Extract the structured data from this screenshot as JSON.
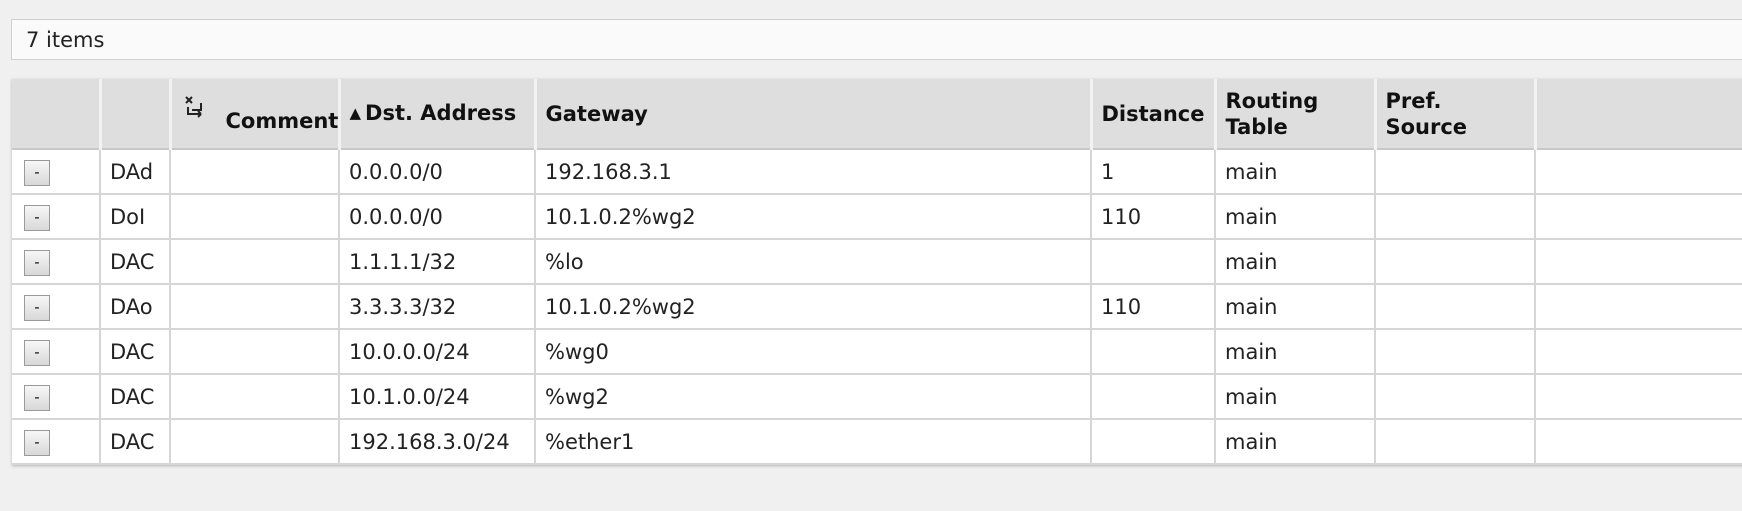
{
  "status": {
    "item_count": "7 items"
  },
  "table": {
    "headers": {
      "comment": "Comment",
      "sort_indicator": "▲",
      "dst_address": "Dst. Address",
      "gateway": "Gateway",
      "distance": "Distance",
      "routing_table": "Routing Table",
      "pref_source": "Pref. Source"
    },
    "remove_label": "-",
    "rows": [
      {
        "flags": "DAd",
        "comment": "",
        "dst": "0.0.0.0/0",
        "gateway": "192.168.3.1",
        "distance": "1",
        "table": "main",
        "pref_source": ""
      },
      {
        "flags": "DoI",
        "comment": "",
        "dst": "0.0.0.0/0",
        "gateway": "10.1.0.2%wg2",
        "distance": "110",
        "table": "main",
        "pref_source": ""
      },
      {
        "flags": "DAC",
        "comment": "",
        "dst": "1.1.1.1/32",
        "gateway": "%lo",
        "distance": "",
        "table": "main",
        "pref_source": ""
      },
      {
        "flags": "DAo",
        "comment": "",
        "dst": "3.3.3.3/32",
        "gateway": "10.1.0.2%wg2",
        "distance": "110",
        "table": "main",
        "pref_source": ""
      },
      {
        "flags": "DAC",
        "comment": "",
        "dst": "10.0.0.0/24",
        "gateway": "%wg0",
        "distance": "",
        "table": "main",
        "pref_source": ""
      },
      {
        "flags": "DAC",
        "comment": "",
        "dst": "10.1.0.0/24",
        "gateway": "%wg2",
        "distance": "",
        "table": "main",
        "pref_source": ""
      },
      {
        "flags": "DAC",
        "comment": "",
        "dst": "192.168.3.0/24",
        "gateway": "%ether1",
        "distance": "",
        "table": "main",
        "pref_source": ""
      }
    ]
  },
  "icons": {
    "comment_toggle": "comment-expand-icon"
  }
}
